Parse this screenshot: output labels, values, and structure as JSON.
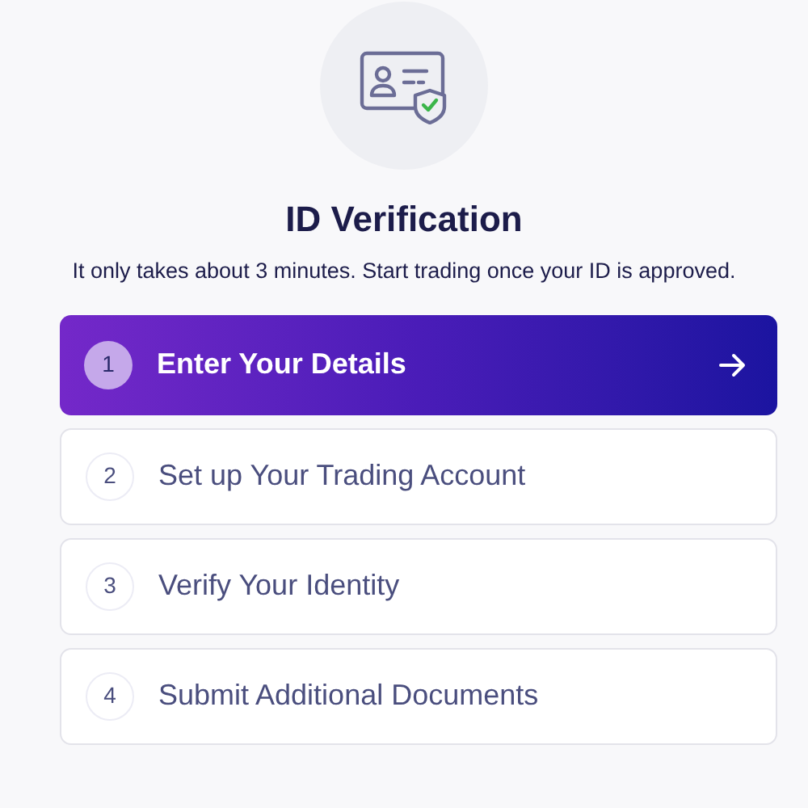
{
  "title": "ID Verification",
  "subtitle": "It only takes about 3 minutes. Start trading once your ID is approved.",
  "steps": [
    {
      "number": "1",
      "label": "Enter Your Details",
      "selected": true
    },
    {
      "number": "2",
      "label": "Set up Your Trading Account",
      "selected": false
    },
    {
      "number": "3",
      "label": "Verify Your Identity",
      "selected": false
    },
    {
      "number": "4",
      "label": "Submit Additional Documents",
      "selected": false
    }
  ]
}
